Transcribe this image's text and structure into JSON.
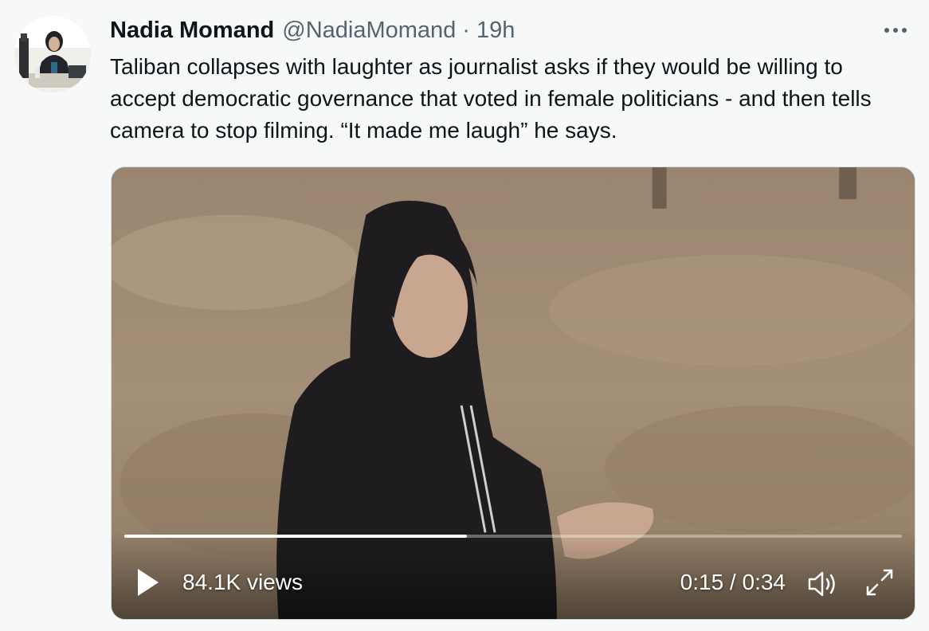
{
  "author": {
    "name": "Nadia Momand",
    "handle": "@NadiaMomand",
    "separator": "·",
    "time": "19h"
  },
  "more_icon": "more-horizontal-icon",
  "tweet": {
    "text": "Taliban collapses with laughter as journalist asks if they would be willing to accept democratic governance that voted in female politicians - and then tells camera to stop filming. “It made me laugh” he says."
  },
  "video": {
    "views": "84.1K views",
    "timecode": "0:15 / 0:34",
    "progress": 0.441,
    "icons": {
      "play": "play-icon",
      "volume": "volume-icon",
      "fullscreen": "fullscreen-icon"
    }
  },
  "colors": {
    "background": "#f7f9f9",
    "text_primary": "#0f1419",
    "text_secondary": "#536471",
    "media_border": "#cfd9de"
  }
}
